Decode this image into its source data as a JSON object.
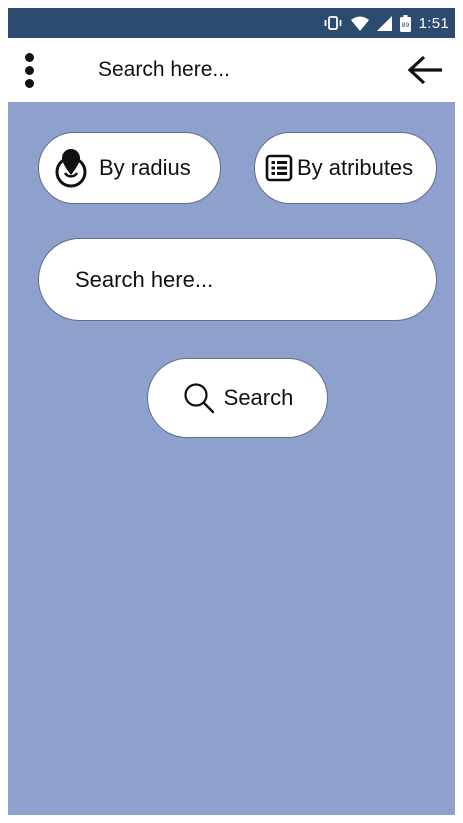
{
  "status_bar": {
    "time": "1:51",
    "icons": [
      "vibrate-icon",
      "wifi-icon",
      "signal-icon",
      "battery-icon"
    ],
    "background": "#2c4b6e"
  },
  "app_bar": {
    "menu_icon": "more-vert-icon",
    "search_placeholder": "Search here...",
    "back_icon": "arrow-back-icon"
  },
  "filters": {
    "radius_label": "By radius",
    "radius_icon": "location-radius-icon",
    "attributes_label": "By atributes",
    "attributes_icon": "list-icon"
  },
  "search": {
    "placeholder": "Search here...",
    "button_label": "Search",
    "button_icon": "search-icon"
  },
  "colors": {
    "background": "#8ea0cc",
    "surface": "#ffffff",
    "text": "#111111"
  }
}
